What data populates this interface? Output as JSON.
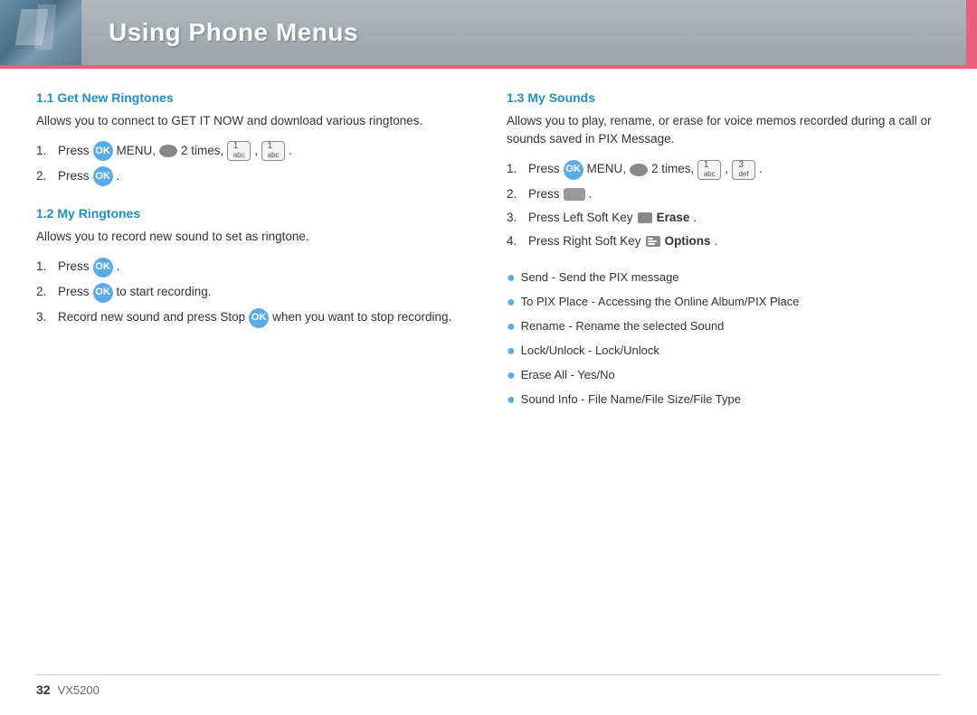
{
  "header": {
    "title": "Using Phone Menus",
    "accent_color": "#e8607a"
  },
  "sections": {
    "left": [
      {
        "id": "section-1-1",
        "title": "1.1 Get New Ringtones",
        "description": "Allows you to connect to GET IT NOW and download various ringtones.",
        "steps": [
          {
            "num": "1.",
            "parts": [
              "Press",
              "OK",
              "MENU,",
              "nav",
              "2 times,",
              "key1",
              ",",
              "key1b",
              "."
            ]
          },
          {
            "num": "2.",
            "parts": [
              "Press",
              "OK",
              "."
            ]
          }
        ]
      },
      {
        "id": "section-1-2",
        "title": "1.2 My Ringtones",
        "description": "Allows you to record new sound to set as ringtone.",
        "steps": [
          {
            "num": "1.",
            "parts": [
              "Press",
              "OK",
              "."
            ]
          },
          {
            "num": "2.",
            "parts": [
              "Press",
              "OK",
              "to start recording."
            ]
          },
          {
            "num": "3.",
            "parts": [
              "Record new sound and press Stop",
              "OK",
              "when you want to stop recording."
            ]
          }
        ]
      }
    ],
    "right": [
      {
        "id": "section-1-3",
        "title": "1.3 My Sounds",
        "description": "Allows you to play, rename, or erase for voice memos recorded during a call or sounds saved in PIX Message.",
        "steps": [
          {
            "num": "1.",
            "parts": [
              "Press",
              "OK",
              "MENU,",
              "nav",
              "2 times,",
              "key1",
              ",",
              "key3",
              "."
            ]
          },
          {
            "num": "2.",
            "parts": [
              "Press",
              "softkey",
              "."
            ]
          },
          {
            "num": "3.",
            "label": "Press Left Soft Key",
            "icon": "erase-icon",
            "bold": "Erase",
            "suffix": "."
          },
          {
            "num": "4.",
            "label": "Press Right Soft Key",
            "icon": "options-icon",
            "bold": "Options",
            "suffix": "."
          }
        ],
        "bullets": [
          "Send - Send the PIX message",
          "To PIX Place - Accessing the Online Album/PIX Place",
          "Rename - Rename the selected Sound",
          "Lock/Unlock - Lock/Unlock",
          "Erase All - Yes/No",
          "Sound Info - File Name/File Size/File Type"
        ]
      }
    ]
  },
  "footer": {
    "page_number": "32",
    "model": "VX5200"
  },
  "labels": {
    "ok": "OK",
    "menu": "MENU,",
    "times": "2 times,",
    "erase": "Erase",
    "options": "Options",
    "press": "Press",
    "press_left_soft_key": "Press Left Soft Key",
    "press_right_soft_key": "Press Right Soft Key",
    "to_start_recording": "to start recording.",
    "record_new_sound": "Record new sound and press Stop",
    "when_stop": "when you want to stop recording.",
    "period": "."
  }
}
